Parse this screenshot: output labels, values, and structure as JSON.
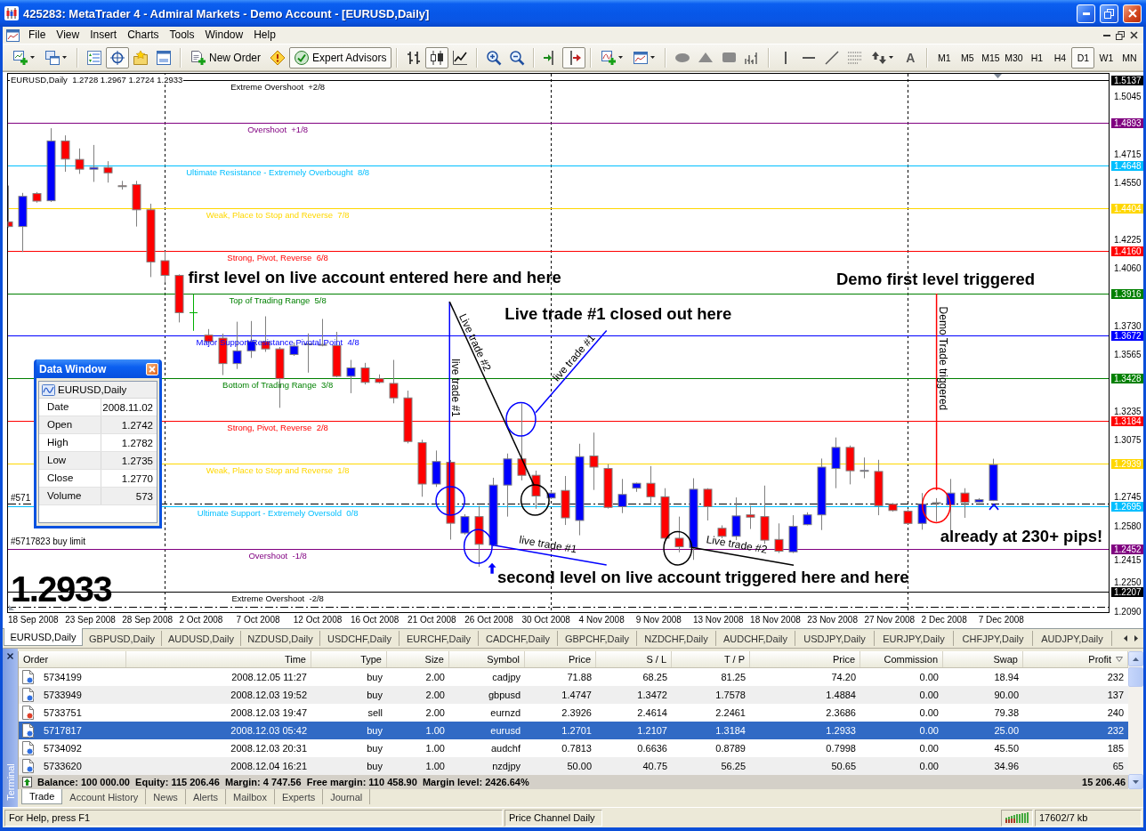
{
  "window": {
    "title": "425283: MetaTrader 4 - Admiral Markets - Demo Account - [EURUSD,Daily]"
  },
  "menu": [
    "File",
    "View",
    "Insert",
    "Charts",
    "Tools",
    "Window",
    "Help"
  ],
  "toolbar": {
    "data_window_on": true,
    "new_order": "New Order",
    "expert_advisors": {
      "label": "Expert Advisors",
      "on": true
    },
    "chart_types": [
      {
        "selected": false
      },
      {
        "selected": true
      },
      {
        "selected": false
      }
    ],
    "auto_scroll_on": true,
    "text_tool": "A",
    "timeframes": [
      {
        "label": "M1",
        "selected": false
      },
      {
        "label": "M5",
        "selected": false
      },
      {
        "label": "M15",
        "selected": false
      },
      {
        "label": "M30",
        "selected": false
      },
      {
        "label": "H1",
        "selected": false
      },
      {
        "label": "H4",
        "selected": false
      },
      {
        "label": "D1",
        "selected": true
      },
      {
        "label": "W1",
        "selected": false
      },
      {
        "label": "MN",
        "selected": false
      }
    ]
  },
  "chart": {
    "header": "EURUSD,Daily  1.2728 1.2967 1.2724 1.2933",
    "levels": [
      {
        "label": "Extreme Overshoot  +2/8",
        "price": "1.5137",
        "color": "#000000"
      },
      {
        "label": "Overshoot  +1/8",
        "price": "1.4893",
        "color": "#800080"
      },
      {
        "label": "Ultimate Resistance - Extremely Overbought  8/8",
        "price": "1.4648",
        "color": "#00bfff"
      },
      {
        "label": "Weak, Place to Stop and Reverse  7/8",
        "price": "1.4404",
        "color": "#ffd700"
      },
      {
        "label": "Strong, Pivot, Reverse  6/8",
        "price": "1.4160",
        "color": "#ff0000"
      },
      {
        "label": "Top of Trading Range  5/8",
        "price": "1.3916",
        "color": "#008000"
      },
      {
        "label": "Major Support/Resistance Pivotal Point  4/8",
        "price": "1.3672",
        "color": "#0000ff"
      },
      {
        "label": "Bottom of Trading Range  3/8",
        "price": "1.3428",
        "color": "#008000"
      },
      {
        "label": "Strong, Pivot, Reverse  2/8",
        "price": "1.3184",
        "color": "#ff0000"
      },
      {
        "label": "Weak, Place to Stop and Reverse  1/8",
        "price": "1.2939",
        "color": "#ffd700"
      },
      {
        "label": "Ultimate Support - Extremely Oversold  0/8",
        "price": "1.2695",
        "color": "#00bfff"
      },
      {
        "label": "Overshoot  -1/8",
        "price": "1.2452",
        "color": "#800080"
      },
      {
        "label": "Extreme Overshoot  -2/8",
        "price": "1.2207",
        "color": "#000000"
      }
    ],
    "orders": [
      "#571",
      "#5717823 buy limit"
    ],
    "line_labels": [
      "live trade #1",
      "Live trade #2",
      "live trade #1",
      "live trade #1",
      "Live trade #2",
      "Demo Trade triggered"
    ],
    "notes": [
      "first level on live account entered here and here",
      "Live trade #1 closed out here",
      "Demo first level triggered",
      "already at 230+ pips!",
      "second level on live account triggered here and here"
    ],
    "price_display": "1.2933",
    "price_axis": [
      "1.5045",
      "1.4715",
      "1.4550",
      "1.4225",
      "1.4060",
      "1.3730",
      "1.3565",
      "1.3235",
      "1.3075",
      "1.2745",
      "1.2580",
      "1.2415",
      "1.2250",
      "1.2090"
    ],
    "time_axis": [
      "18 Sep 2008",
      "23 Sep 2008",
      "28 Sep 2008",
      "2 Oct 2008",
      "7 Oct 2008",
      "12 Oct 2008",
      "16 Oct 2008",
      "21 Oct 2008",
      "26 Oct 2008",
      "30 Oct 2008",
      "4 Nov 2008",
      "9 Nov 2008",
      "13 Nov 2008",
      "18 Nov 2008",
      "23 Nov 2008",
      "27 Nov 2008",
      "2 Dec 2008",
      "7 Dec 2008"
    ]
  },
  "data_window": {
    "title": "Data Window",
    "symbol": "EURUSD,Daily",
    "rows": [
      {
        "label": "Date",
        "value": "2008.11.02"
      },
      {
        "label": "Open",
        "value": "1.2742"
      },
      {
        "label": "High",
        "value": "1.2782"
      },
      {
        "label": "Low",
        "value": "1.2735"
      },
      {
        "label": "Close",
        "value": "1.2770"
      },
      {
        "label": "Volume",
        "value": "573"
      }
    ]
  },
  "chart_tabs": [
    {
      "label": "EURUSD,Daily",
      "selected": true
    },
    {
      "label": "GBPUSD,Daily",
      "selected": false
    },
    {
      "label": "AUDUSD,Daily",
      "selected": false
    },
    {
      "label": "NZDUSD,Daily",
      "selected": false
    },
    {
      "label": "USDCHF,Daily",
      "selected": false
    },
    {
      "label": "EURCHF,Daily",
      "selected": false
    },
    {
      "label": "CADCHF,Daily",
      "selected": false
    },
    {
      "label": "GBPCHF,Daily",
      "selected": false
    },
    {
      "label": "NZDCHF,Daily",
      "selected": false
    },
    {
      "label": "AUDCHF,Daily",
      "selected": false
    },
    {
      "label": "USDJPY,Daily",
      "selected": false
    },
    {
      "label": "EURJPY,Daily",
      "selected": false
    },
    {
      "label": "CHFJPY,Daily",
      "selected": false
    },
    {
      "label": "AUDJPY,Daily",
      "selected": false
    }
  ],
  "terminal": {
    "title": "Terminal",
    "columns": [
      {
        "label": "Order",
        "sorted": false
      },
      {
        "label": "Time",
        "sorted": false
      },
      {
        "label": "Type",
        "sorted": false
      },
      {
        "label": "Size",
        "sorted": false
      },
      {
        "label": "Symbol",
        "sorted": false
      },
      {
        "label": "Price",
        "sorted": false
      },
      {
        "label": "S / L",
        "sorted": false
      },
      {
        "label": "T / P",
        "sorted": false
      },
      {
        "label": "Price",
        "sorted": false
      },
      {
        "label": "Commission",
        "sorted": false
      },
      {
        "label": "Swap",
        "sorted": false
      },
      {
        "label": "Profit",
        "sorted": true
      }
    ],
    "rows": [
      {
        "kind": "buy",
        "selected": false,
        "cells": [
          "5734199",
          "2008.12.05 11:27",
          "buy",
          "2.00",
          "cadjpy",
          "71.88",
          "68.25",
          "81.25",
          "74.20",
          "0.00",
          "18.94",
          "232"
        ]
      },
      {
        "kind": "buy",
        "selected": false,
        "cells": [
          "5733949",
          "2008.12.03 19:52",
          "buy",
          "2.00",
          "gbpusd",
          "1.4747",
          "1.3472",
          "1.7578",
          "1.4884",
          "0.00",
          "90.00",
          "137"
        ]
      },
      {
        "kind": "sell",
        "selected": false,
        "cells": [
          "5733751",
          "2008.12.03 19:47",
          "sell",
          "2.00",
          "eurnzd",
          "2.3926",
          "2.4614",
          "2.2461",
          "2.3686",
          "0.00",
          "79.38",
          "240"
        ]
      },
      {
        "kind": "buy",
        "selected": true,
        "cells": [
          "5717817",
          "2008.12.03 05:42",
          "buy",
          "1.00",
          "eurusd",
          "1.2701",
          "1.2107",
          "1.3184",
          "1.2933",
          "0.00",
          "25.00",
          "232"
        ]
      },
      {
        "kind": "buy",
        "selected": false,
        "cells": [
          "5734092",
          "2008.12.03 20:31",
          "buy",
          "1.00",
          "audchf",
          "0.7813",
          "0.6636",
          "0.8789",
          "0.7998",
          "0.00",
          "45.50",
          "185"
        ]
      },
      {
        "kind": "buy",
        "selected": false,
        "cells": [
          "5733620",
          "2008.12.04 16:21",
          "buy",
          "1.00",
          "nzdjpy",
          "50.00",
          "40.75",
          "56.25",
          "50.65",
          "0.00",
          "34.96",
          "65"
        ]
      }
    ],
    "summary": {
      "text": "Balance: 100 000.00  Equity: 115 206.46  Margin: 4 747.56  Free margin: 110 458.90  Margin level: 2426.64%",
      "profit": "15 206.46"
    },
    "tabs": [
      {
        "label": "Trade",
        "selected": true
      },
      {
        "label": "Account History",
        "selected": false
      },
      {
        "label": "News",
        "selected": false
      },
      {
        "label": "Alerts",
        "selected": false
      },
      {
        "label": "Mailbox",
        "selected": false
      },
      {
        "label": "Experts",
        "selected": false
      },
      {
        "label": "Journal",
        "selected": false
      }
    ]
  },
  "status_bar": {
    "help": "For Help, press F1",
    "profile": "Price Channel Daily",
    "traffic": "17602/7 kb"
  }
}
